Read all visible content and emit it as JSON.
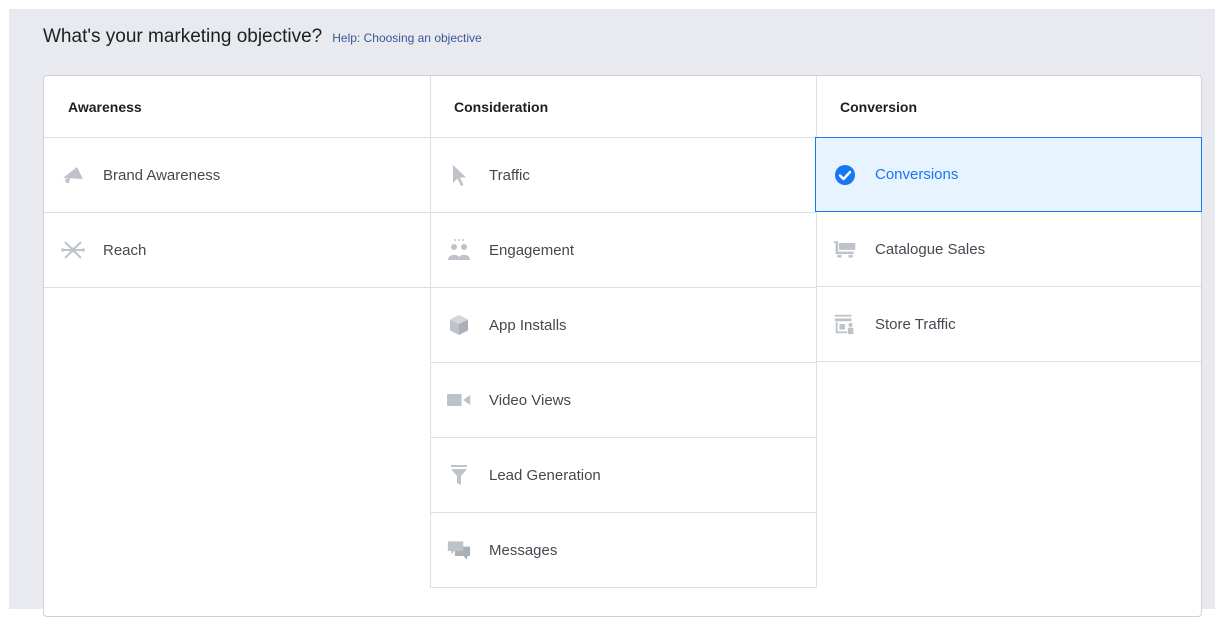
{
  "header": {
    "title": "What's your marketing objective?",
    "help_link": "Help: Choosing an objective"
  },
  "columns": [
    {
      "heading": "Awareness",
      "items": [
        {
          "label": "Brand Awareness",
          "icon": "megaphone-icon"
        },
        {
          "label": "Reach",
          "icon": "reach-network-icon"
        }
      ]
    },
    {
      "heading": "Consideration",
      "items": [
        {
          "label": "Traffic",
          "icon": "cursor-icon"
        },
        {
          "label": "Engagement",
          "icon": "people-icon"
        },
        {
          "label": "App Installs",
          "icon": "cube-box-icon"
        },
        {
          "label": "Video Views",
          "icon": "video-camera-icon"
        },
        {
          "label": "Lead Generation",
          "icon": "funnel-icon"
        },
        {
          "label": "Messages",
          "icon": "chat-bubbles-icon"
        }
      ]
    },
    {
      "heading": "Conversion",
      "items": [
        {
          "label": "Conversions",
          "icon": "checkmark-circle-icon",
          "selected": true
        },
        {
          "label": "Catalogue Sales",
          "icon": "shopping-cart-icon"
        },
        {
          "label": "Store Traffic",
          "icon": "storefront-icon"
        }
      ]
    }
  ],
  "colors": {
    "accent": "#1877f2",
    "selected_bg": "#e7f3ff",
    "icon_gray": "#bec3c9",
    "help_link": "#385898"
  }
}
